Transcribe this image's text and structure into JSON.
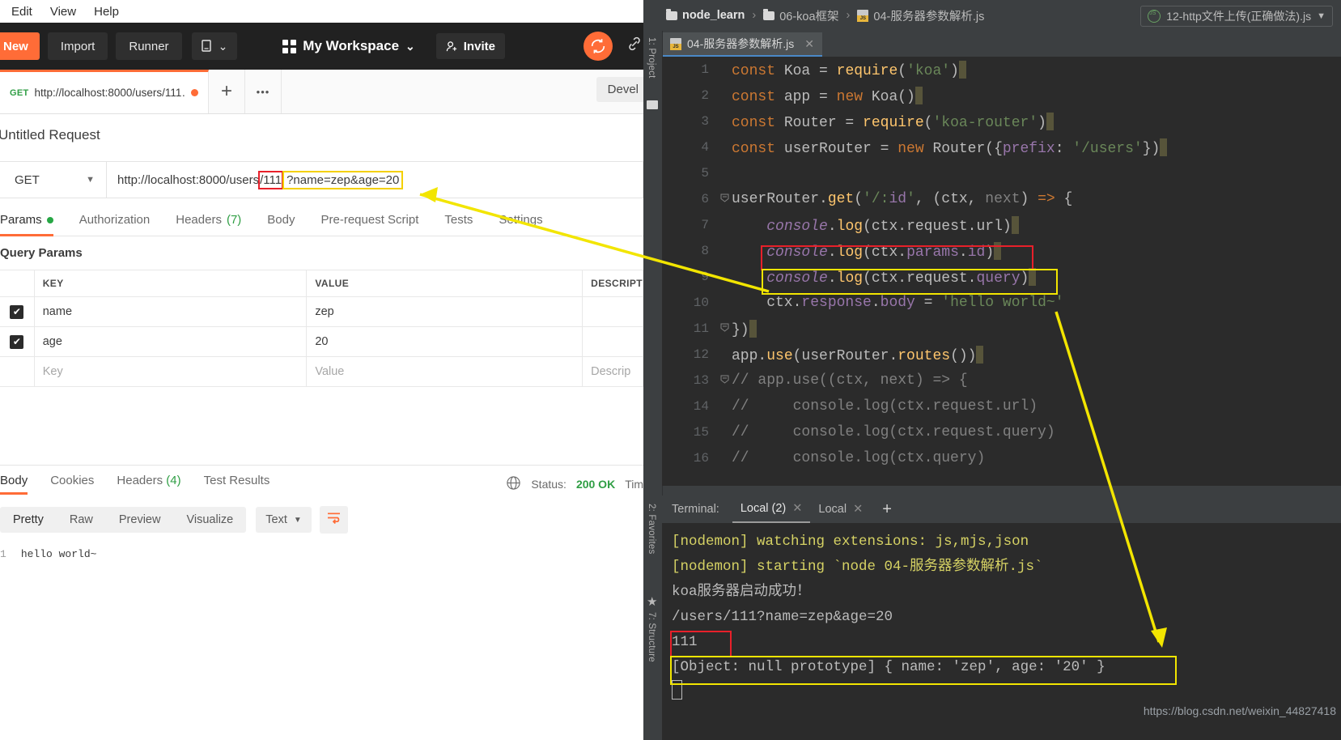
{
  "postman": {
    "menubar": [
      "Edit",
      "View",
      "Help"
    ],
    "toolbar": {
      "new_label": "New",
      "import_label": "Import",
      "runner_label": "Runner",
      "workspace_label": "My Workspace",
      "invite_label": "Invite",
      "sync_icon": "sync-icon",
      "link_icon": "link-icon"
    },
    "request_tab": {
      "method": "GET",
      "url": "http://localhost:8000/users/111…",
      "unsaved": true
    },
    "tabstrip": {
      "new_tab_label": "+",
      "more_label": "•••",
      "developer_label": "Devel"
    },
    "request_name": "Untitled Request",
    "url_bar": {
      "method": "GET",
      "url_prefix": "http://localhost:8000/users",
      "url_highlight_red": "/111",
      "url_highlight_yellow": "?name=zep&age=20"
    },
    "request_tabs": [
      {
        "label": "Params",
        "badge": "dot",
        "active": true
      },
      {
        "label": "Authorization",
        "badge": "",
        "active": false
      },
      {
        "label": "Headers",
        "badge": "(7)",
        "active": false
      },
      {
        "label": "Body",
        "badge": "",
        "active": false
      },
      {
        "label": "Pre-request Script",
        "badge": "",
        "active": false
      },
      {
        "label": "Tests",
        "badge": "",
        "active": false
      },
      {
        "label": "Settings",
        "badge": "",
        "active": false
      }
    ],
    "query_params": {
      "section_title": "Query Params",
      "columns": [
        "KEY",
        "VALUE",
        "DESCRIPT"
      ],
      "rows": [
        {
          "checked": true,
          "key": "name",
          "value": "zep",
          "description": ""
        },
        {
          "checked": true,
          "key": "age",
          "value": "20",
          "description": ""
        }
      ],
      "placeholder_row": {
        "key": "Key",
        "value": "Value",
        "description": "Descrip"
      }
    },
    "response": {
      "tabs": [
        {
          "label": "Body",
          "badge": "",
          "active": true
        },
        {
          "label": "Cookies",
          "badge": "",
          "active": false
        },
        {
          "label": "Headers",
          "badge": "(4)",
          "active": false
        },
        {
          "label": "Test Results",
          "badge": "",
          "active": false
        }
      ],
      "globe_icon": "globe-icon",
      "status_label": "Status:",
      "status_value": "200 OK",
      "time_label": "Tim",
      "view_modes": [
        "Pretty",
        "Raw",
        "Preview",
        "Visualize"
      ],
      "active_view": "Pretty",
      "format": "Text",
      "wrap_icon": "wrap-lines-icon",
      "body_line_number": "1",
      "body_text": "hello world~"
    }
  },
  "ide": {
    "breadcrumbs": [
      {
        "label": "node_learn",
        "icon": "folder-icon",
        "bold": true
      },
      {
        "label": "06-koa框架",
        "icon": "folder-icon",
        "bold": false
      },
      {
        "label": "04-服务器参数解析.js",
        "icon": "js-file-icon",
        "bold": false
      }
    ],
    "run_config": "12-http文件上传(正确做法).js",
    "editor_tab": "04-服务器参数解析.js",
    "sidebar_labels": [
      "1: Project",
      "2: Favorites",
      "7: Structure"
    ],
    "code_lines": [
      {
        "n": "1",
        "fold": "",
        "text": "const Koa = require('koa')"
      },
      {
        "n": "2",
        "fold": "",
        "text": "const app = new Koa()"
      },
      {
        "n": "3",
        "fold": "",
        "text": "const Router = require('koa-router')"
      },
      {
        "n": "4",
        "fold": "",
        "text": "const userRouter = new Router({prefix: '/users'})"
      },
      {
        "n": "5",
        "fold": "",
        "text": ""
      },
      {
        "n": "6",
        "fold": "-",
        "text": "userRouter.get('/:id', (ctx, next) => {"
      },
      {
        "n": "7",
        "fold": "",
        "text": "    console.log(ctx.request.url)"
      },
      {
        "n": "8",
        "fold": "",
        "text": "    console.log(ctx.params.id)"
      },
      {
        "n": "9",
        "fold": "",
        "text": "    console.log(ctx.request.query)"
      },
      {
        "n": "10",
        "fold": "",
        "text": "    ctx.response.body = 'hello world~'"
      },
      {
        "n": "11",
        "fold": "-",
        "text": "})"
      },
      {
        "n": "12",
        "fold": "",
        "text": "app.use(userRouter.routes())"
      },
      {
        "n": "13",
        "fold": "-",
        "text": "// app.use((ctx, next) => {"
      },
      {
        "n": "14",
        "fold": "",
        "text": "//     console.log(ctx.request.url)"
      },
      {
        "n": "15",
        "fold": "",
        "text": "//     console.log(ctx.request.query)"
      },
      {
        "n": "16",
        "fold": "",
        "text": "//     console.log(ctx.query)"
      }
    ],
    "terminal": {
      "label": "Terminal:",
      "tabs": [
        {
          "label": "Local (2)",
          "active": true
        },
        {
          "label": "Local",
          "active": false
        }
      ],
      "add_label": "+",
      "lines": [
        {
          "text": "[nodemon] watching extensions: js,mjs,json",
          "color": "yellow"
        },
        {
          "text": "[nodemon] starting `node 04-服务器参数解析.js`",
          "color": "yellow"
        },
        {
          "text": "koa服务器启动成功！",
          "color": "grey"
        },
        {
          "text": "/users/111?name=zep&age=20",
          "color": "grey"
        },
        {
          "text": "111",
          "color": "grey"
        },
        {
          "text": "[Object: null prototype] { name: 'zep', age: '20' }",
          "color": "grey"
        }
      ]
    },
    "watermark": "https://blog.csdn.net/weixin_44827418"
  },
  "annotations": {
    "red_color": "#e8202a",
    "yellow_color": "#f2e500",
    "arrow1_desc": "arrow from url query highlight to code line 9",
    "arrow2_desc": "arrow from code line 10 area to terminal query output"
  }
}
